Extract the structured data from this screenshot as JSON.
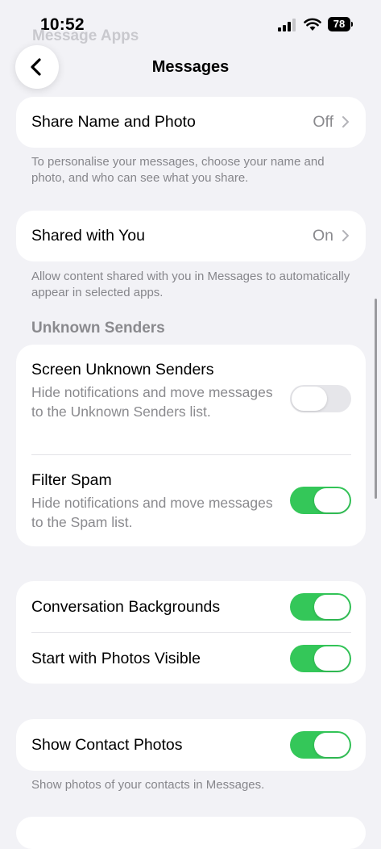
{
  "status_bar": {
    "time": "10:52",
    "battery": "78",
    "icons": [
      "signal-icon",
      "wifi-icon",
      "battery-icon"
    ]
  },
  "nav": {
    "back_icon": "chevron-left-icon",
    "title": "Messages",
    "ghost_title": "Message Apps"
  },
  "share_name": {
    "label": "Share Name and Photo",
    "value": "Off",
    "footer": "To personalise your messages, choose your name and photo, and who can see what you share."
  },
  "shared_with_you": {
    "label": "Shared with You",
    "value": "On",
    "footer": "Allow content shared with you in Messages to automatically appear in selected apps."
  },
  "unknown_senders": {
    "header": "Unknown Senders",
    "screen": {
      "label": "Screen Unknown Senders",
      "description": "Hide notifications and move messages to the Unknown Senders list.",
      "enabled": false
    },
    "filter_spam": {
      "label": "Filter Spam",
      "description": "Hide notifications and move messages to the Spam list.",
      "enabled": true
    }
  },
  "display": {
    "conversation_backgrounds": {
      "label": "Conversation Backgrounds",
      "enabled": true
    },
    "photos_visible": {
      "label": "Start with Photos Visible",
      "enabled": true
    }
  },
  "contact_photos": {
    "label": "Show Contact Photos",
    "enabled": true,
    "footer": "Show photos of your contacts in Messages."
  },
  "colors": {
    "toggle_on": "#34c759",
    "toggle_off": "#e6e6ea",
    "background": "#f2f2f6",
    "secondary_text": "#8a8a8e"
  }
}
